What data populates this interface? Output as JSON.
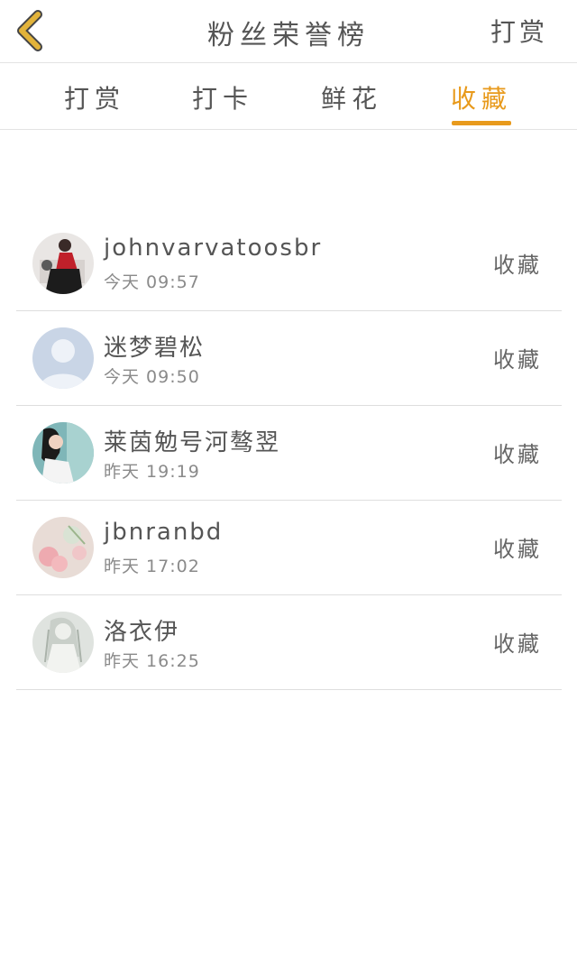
{
  "header": {
    "title": "粉丝荣誉榜",
    "action_label": "打赏",
    "back_icon": "chevron-left-icon",
    "back_icon_color": "#e2b33a"
  },
  "tabs": [
    {
      "label": "打赏",
      "active": false
    },
    {
      "label": "打卡",
      "active": false
    },
    {
      "label": "鲜花",
      "active": false
    },
    {
      "label": "收藏",
      "active": true
    }
  ],
  "accent_color": "#e89a1c",
  "list": [
    {
      "name": "johnvarvatoosbr",
      "time": "今天 09:57",
      "action": "收藏"
    },
    {
      "name": "迷梦碧松",
      "time": "今天 09:50",
      "action": "收藏"
    },
    {
      "name": "莱茵勉号河骜翌",
      "time": "昨天 19:19",
      "action": "收藏"
    },
    {
      "name": "jbnranbd",
      "time": "昨天 17:02",
      "action": "收藏"
    },
    {
      "name": "洛衣伊",
      "time": "昨天 16:25",
      "action": "收藏"
    }
  ]
}
